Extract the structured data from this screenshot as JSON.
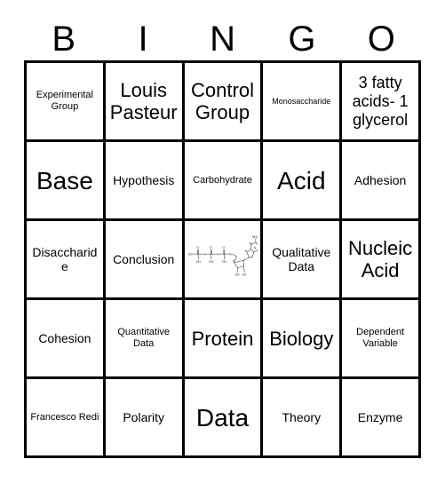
{
  "card": {
    "title": "BINGO",
    "header_letters": [
      "B",
      "I",
      "N",
      "G",
      "O"
    ],
    "border_color": "#000000",
    "background_color": "#ffffff",
    "grid_size": "5x5",
    "rows": [
      [
        {
          "text": "Experimental Group",
          "size": "t-sm"
        },
        {
          "text": "Louis Pasteur",
          "size": "t-xl"
        },
        {
          "text": "Control Group",
          "size": "t-xl"
        },
        {
          "text": "Monosaccharide",
          "size": "t-xs"
        },
        {
          "text": "3 fatty acids- 1 glycerol",
          "size": "t-lg"
        }
      ],
      [
        {
          "text": "Base",
          "size": "t-xxl"
        },
        {
          "text": "Hypothesis",
          "size": "t-md"
        },
        {
          "text": "Carbohydrate",
          "size": "t-sm"
        },
        {
          "text": "Acid",
          "size": "t-xxl"
        },
        {
          "text": "Adhesion",
          "size": "t-md"
        }
      ],
      [
        {
          "text": "Disaccharide",
          "size": "t-md"
        },
        {
          "text": "Conclusion",
          "size": "t-md"
        },
        {
          "text": "",
          "size": "t-md",
          "image": "atp-molecule-diagram"
        },
        {
          "text": "Qualitative Data",
          "size": "t-md"
        },
        {
          "text": "Nucleic Acid",
          "size": "t-xl"
        }
      ],
      [
        {
          "text": "Cohesion",
          "size": "t-md"
        },
        {
          "text": "Quantitative Data",
          "size": "t-sm"
        },
        {
          "text": "Protein",
          "size": "t-xl"
        },
        {
          "text": "Biology",
          "size": "t-xl"
        },
        {
          "text": "Dependent Variable",
          "size": "t-sm"
        }
      ],
      [
        {
          "text": "Francesco Redi",
          "size": "t-sm"
        },
        {
          "text": "Polarity",
          "size": "t-md"
        },
        {
          "text": "Data",
          "size": "t-xxl"
        },
        {
          "text": "Theory",
          "size": "t-md"
        },
        {
          "text": "Enzyme",
          "size": "t-md"
        }
      ]
    ]
  },
  "molecule": {
    "name": "atp-molecule-diagram",
    "labels": [
      "HO",
      "O",
      "OH",
      "OH",
      "OH",
      "O",
      "O",
      "N",
      "N",
      "N",
      "N",
      "NH2",
      "OH",
      "OH"
    ]
  }
}
